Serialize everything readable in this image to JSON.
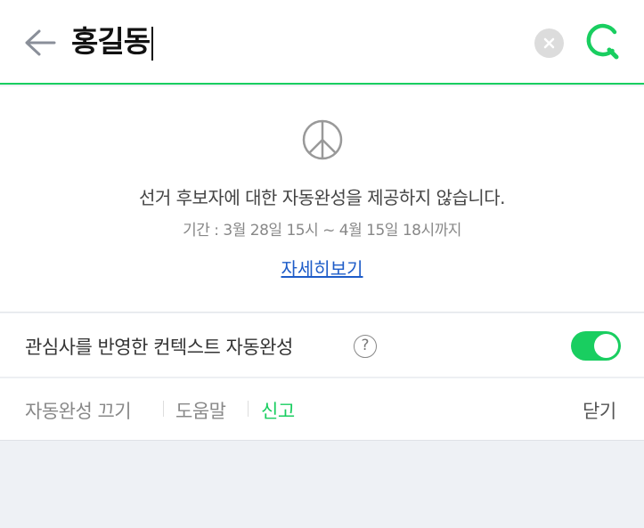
{
  "search": {
    "query": "홍길동",
    "back_icon": "arrow-left-icon",
    "clear_icon": "clear-x-icon",
    "search_icon": "green-search-icon",
    "accent": "#19ce60"
  },
  "notice": {
    "icon": "election-peace-icon",
    "message": "선거 후보자에 대한 자동완성을 제공하지 않습니다.",
    "period": "기간 : 3월 28일 15시 ~ 4월 15일 18시까지",
    "link": "자세히보기",
    "link_color": "#1e5cc8"
  },
  "context": {
    "label": "관심사를 반영한 컨텍스트 자동완성",
    "help": "?",
    "toggle_on": true
  },
  "footer": {
    "turn_off": "자동완성 끄기",
    "help": "도움말",
    "report": "신고",
    "close": "닫기",
    "report_color": "#19ce60"
  }
}
